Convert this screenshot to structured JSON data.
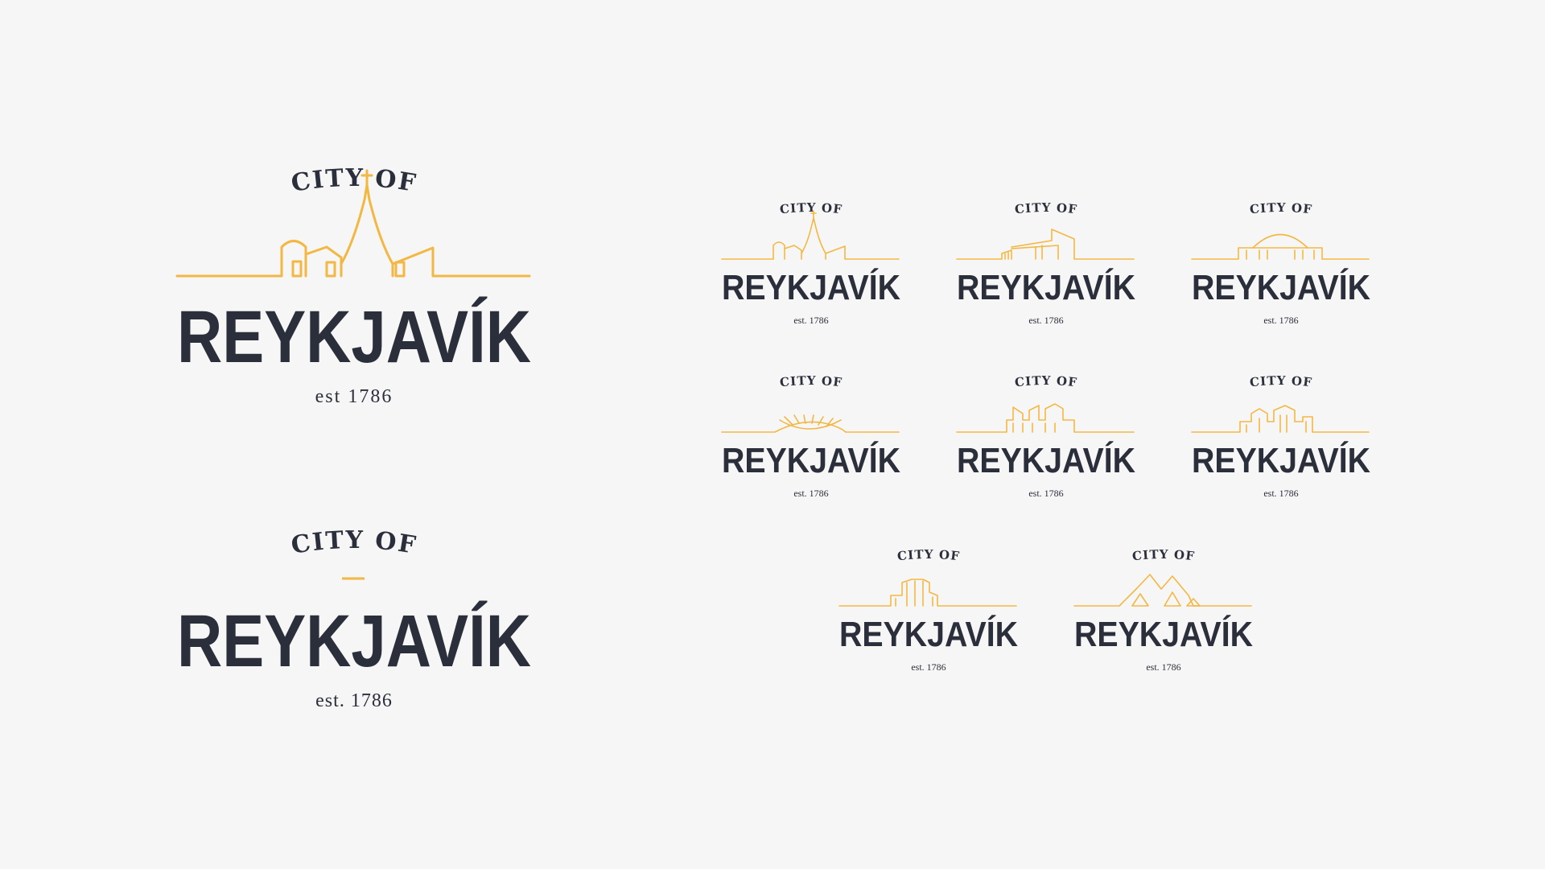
{
  "colors": {
    "accent": "#f3b743",
    "ink": "#2b2f3b",
    "background": "#f6f6f6"
  },
  "primary_logo": {
    "top_text": "CITY OF",
    "name": "REYKJAVÍK",
    "tagline": "est  1786",
    "skyline": "church-skyline"
  },
  "secondary_logo": {
    "top_text": "CITY OF",
    "name": "REYKJAVÍK",
    "tagline": "est. 1786"
  },
  "variants": [
    {
      "top_text": "CITY OF",
      "name": "REYKJAVÍK",
      "tagline": "est. 1786",
      "skyline": "church-skyline"
    },
    {
      "top_text": "CITY OF",
      "name": "REYKJAVÍK",
      "tagline": "est. 1786",
      "skyline": "harpa-skyline"
    },
    {
      "top_text": "CITY OF",
      "name": "REYKJAVÍK",
      "tagline": "est. 1786",
      "skyline": "dome-skyline"
    },
    {
      "top_text": "CITY OF",
      "name": "REYKJAVÍK",
      "tagline": "est. 1786",
      "skyline": "viking-ship-skyline"
    },
    {
      "top_text": "CITY OF",
      "name": "REYKJAVÍK",
      "tagline": "est. 1786",
      "skyline": "rooftops-skyline"
    },
    {
      "top_text": "CITY OF",
      "name": "REYKJAVÍK",
      "tagline": "est. 1786",
      "skyline": "houses-skyline"
    },
    {
      "top_text": "CITY OF",
      "name": "REYKJAVÍK",
      "tagline": "est. 1786",
      "skyline": "towers-skyline"
    },
    {
      "top_text": "CITY OF",
      "name": "REYKJAVÍK",
      "tagline": "est. 1786",
      "skyline": "mountains-skyline"
    }
  ]
}
